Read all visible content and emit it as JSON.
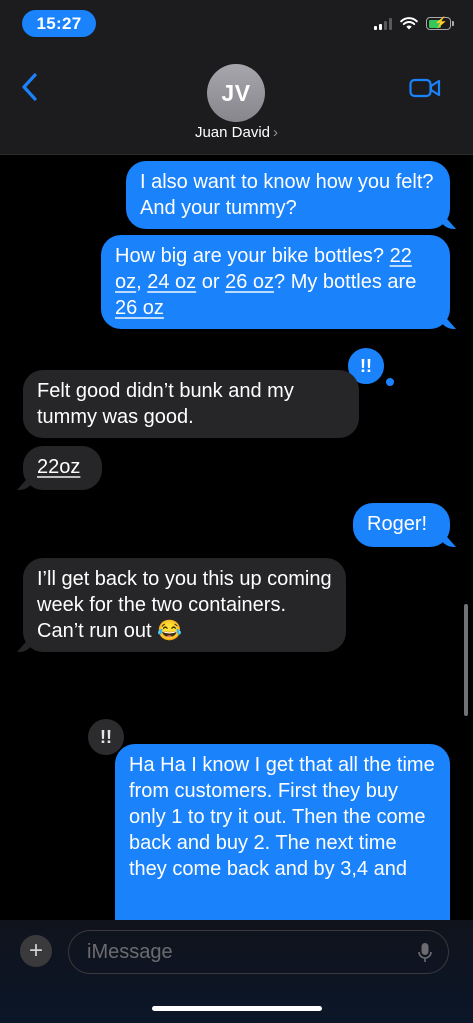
{
  "status_bar": {
    "time": "15:27"
  },
  "header": {
    "contact_initials": "JV",
    "contact_name": "Juan David",
    "chevron": "›",
    "back_icon": "chevron-left-icon",
    "video_icon": "video-camera-icon"
  },
  "messages": [
    {
      "side": "sent",
      "text": "I also want to know how you felt?  And your tummy?"
    },
    {
      "side": "sent",
      "segments": [
        "How big are your bike bottles? ",
        "22 oz",
        ", ",
        "24 oz",
        " or ",
        "26 oz",
        "?  My bottles are ",
        "26 oz"
      ]
    },
    {
      "side": "received",
      "text": "Felt good didn’t bunk and my tummy was good.",
      "tapback": "!!"
    },
    {
      "side": "received",
      "text": "22oz"
    },
    {
      "side": "sent",
      "text": "Roger!"
    },
    {
      "side": "received",
      "text": "I’ll get back to you this up coming week for the two containers. Can’t run out 😂"
    },
    {
      "side": "sent",
      "text": "Ha Ha I know I get that all the time from customers.  First they buy only 1 to try it out. Then the come back and buy 2.  The next time they come back and by 3,4 and",
      "tapback": "!!"
    }
  ],
  "composer": {
    "placeholder": "iMessage",
    "plus_label": "+"
  },
  "colors": {
    "sent": "#1a82fb",
    "received": "#262628",
    "background": "#000000"
  }
}
